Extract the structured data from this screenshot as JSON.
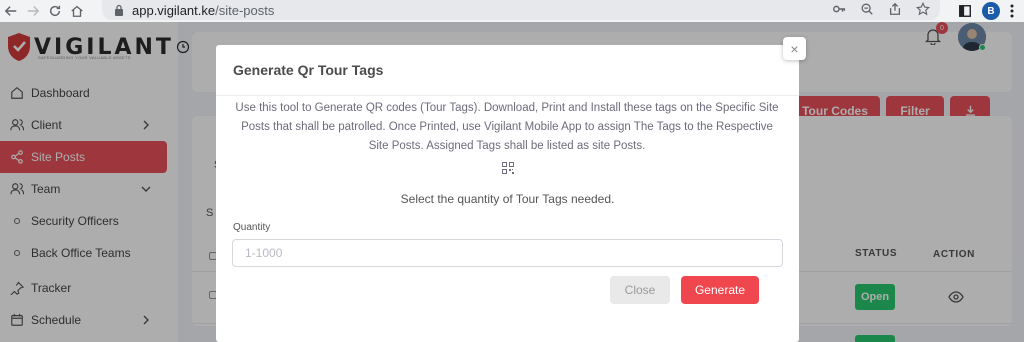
{
  "browser": {
    "url_host": "app.vigilant.ke",
    "url_path": "/site-posts",
    "profile_initial": "B"
  },
  "logo": {
    "brand": "VIGILANT",
    "tagline": "SAFEGUARDING YOUR VALUABLE ASSETS"
  },
  "sidebar": {
    "items": [
      {
        "label": "Dashboard",
        "icon": "home-icon"
      },
      {
        "label": "Client",
        "icon": "users-icon"
      },
      {
        "label": "Site Posts",
        "icon": "share-icon"
      },
      {
        "label": "Team",
        "icon": "users-icon"
      },
      {
        "label": "Security Officers"
      },
      {
        "label": "Back Office Teams"
      },
      {
        "label": "Tracker",
        "icon": "pin-icon"
      },
      {
        "label": "Schedule",
        "icon": "calendar-icon"
      }
    ]
  },
  "header": {
    "notification_count": "0"
  },
  "toolbar": {
    "tour_codes_label": "R Tour Codes",
    "filter_label": "Filter"
  },
  "table": {
    "fragment_s1": "S",
    "fragment_s2": "S",
    "status_header": "STATUS",
    "action_header": "ACTION",
    "rows": [
      {
        "status": "Open"
      }
    ]
  },
  "modal": {
    "title": "Generate Qr Tour Tags",
    "description": "Use this tool to Generate QR codes (Tour Tags). Download, Print and Install these tags on the Specific Site Posts that shall be patrolled. Once Printed, use Vigilant Mobile App to assign The Tags to the Respective Site Posts. Assigned Tags shall be listed as site Posts.",
    "select_prompt": "Select the quantity of Tour Tags needed.",
    "quantity_label": "Quantity",
    "quantity_placeholder": "1-1000",
    "quantity_value": "",
    "close_label": "Close",
    "generate_label": "Generate",
    "dismiss_symbol": "×"
  },
  "colors": {
    "accent_red": "#e8525a",
    "status_green": "#28c76f"
  }
}
